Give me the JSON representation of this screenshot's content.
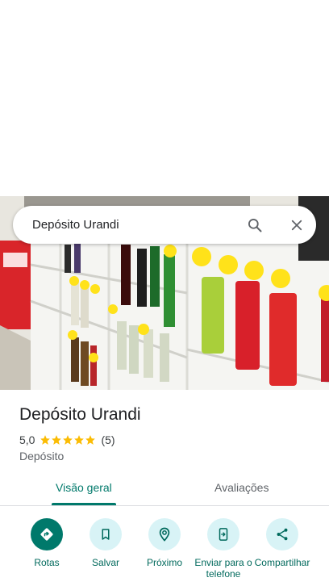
{
  "search": {
    "query": "Depósito Urandi"
  },
  "place": {
    "name": "Depósito Urandi",
    "rating": "5,0",
    "stars": 5,
    "review_count": "(5)",
    "category": "Depósito"
  },
  "tabs": [
    {
      "label": "Visão geral",
      "selected": true
    },
    {
      "label": "Avaliações",
      "selected": false
    }
  ],
  "actions": [
    {
      "label": "Rotas",
      "icon": "directions-icon"
    },
    {
      "label": "Salvar",
      "icon": "bookmark-icon"
    },
    {
      "label": "Próximo",
      "icon": "nearby-icon"
    },
    {
      "label": "Enviar para o telefone",
      "icon": "send-to-phone-icon"
    },
    {
      "label": "Compartilhar",
      "icon": "share-icon"
    }
  ],
  "colors": {
    "accent": "#00796b",
    "action_circle": "#d8f3f6",
    "star": "#fbbc04"
  }
}
